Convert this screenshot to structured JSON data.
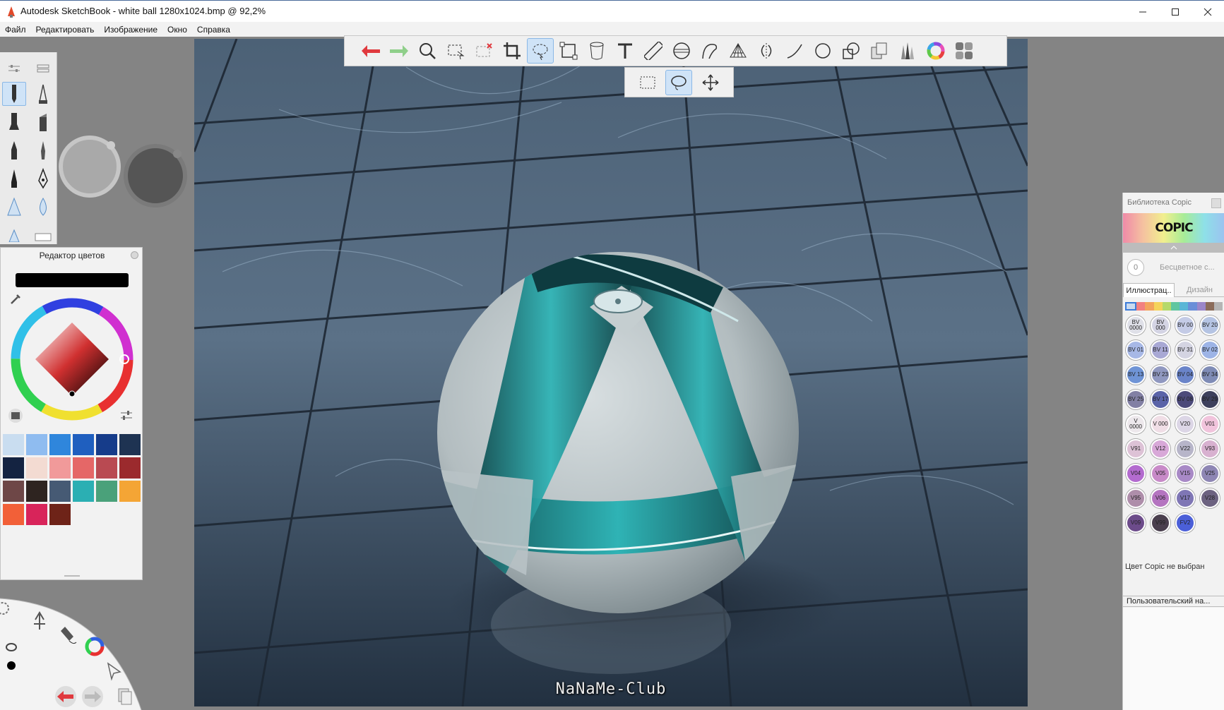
{
  "window": {
    "title": "Autodesk SketchBook - white ball 1280x1024.bmp @ 92,2%"
  },
  "menu": [
    "Файл",
    "Редактировать",
    "Изображение",
    "Окно",
    "Справка"
  ],
  "toolbar": {
    "icons": [
      "undo-icon",
      "redo-icon",
      "zoom-icon",
      "select-icon",
      "deselect-icon",
      "crop-icon",
      "lasso-select-icon",
      "transform-icon",
      "fill-icon",
      "text-icon",
      "ruler-icon",
      "ellipse-guide-icon",
      "french-curve-icon",
      "perspective-icon",
      "symmetry-icon",
      "line-icon",
      "circle-icon",
      "shape-icon",
      "layer-icon",
      "brush-library-icon",
      "color-wheel-icon",
      "copic-library-icon"
    ],
    "active": "lasso-select-icon",
    "colors": {
      "undo": "#e0393e",
      "redo": "#8fcf8a",
      "active_bg": "#cfe3f7"
    }
  },
  "selection_subbar": {
    "icons": [
      "rectangle-select-icon",
      "lasso-select-icon",
      "move-select-icon"
    ],
    "active": "lasso-select-icon"
  },
  "canvas": {
    "watermark": "NaNaMe-Club"
  },
  "color_editor": {
    "title": "Редактор цветов",
    "current_color": "#000000",
    "swatches": [
      "#c9ddf0",
      "#8fbcf0",
      "#2f86dc",
      "#1f5fbf",
      "#163c8a",
      "#1e3352",
      "#142341",
      "#f3dbd2",
      "#f19a9a",
      "#e56767",
      "#b94a52",
      "#9b2a2d",
      "#6e4747",
      "#2e2420",
      "#465a74",
      "#2bafb3",
      "#4aa17a",
      "#f4a535",
      "#f26038",
      "#d8245a",
      "#6e2318"
    ]
  },
  "copic_library": {
    "title": "Библиотека Copic",
    "logo": "COPIC",
    "blender_value": "0",
    "blender_label": "Бесцветное с...",
    "tabs": [
      "Иллюстрац..",
      "Дизайн"
    ],
    "active_tab": "Иллюстрац..",
    "hue_strip": [
      "#f3a6b7",
      "#f28080",
      "#f3a45d",
      "#f5d35a",
      "#b5d96a",
      "#60c6a0",
      "#5ab6d6",
      "#6a8ed8",
      "#9b86c9",
      "#8b6c5a",
      "#b5b5b5"
    ],
    "colors": [
      {
        "code": "BV 0000",
        "color": "#dfe0e8"
      },
      {
        "code": "BV 000",
        "color": "#d4d4e4"
      },
      {
        "code": "BV 00",
        "color": "#c4cbe6"
      },
      {
        "code": "BV 20",
        "color": "#b5c4e3"
      },
      {
        "code": "BV 01",
        "color": "#a7b8e6"
      },
      {
        "code": "BV 11",
        "color": "#a8a8d4"
      },
      {
        "code": "BV 31",
        "color": "#d4d4e2"
      },
      {
        "code": "BV 02",
        "color": "#9db4e6"
      },
      {
        "code": "BV 13",
        "color": "#6f94d6"
      },
      {
        "code": "BV 23",
        "color": "#9098c0"
      },
      {
        "code": "BV 04",
        "color": "#6a84c9"
      },
      {
        "code": "BV 34",
        "color": "#7f8cb6"
      },
      {
        "code": "BV 25",
        "color": "#8280a4"
      },
      {
        "code": "BV 17",
        "color": "#5a63a8"
      },
      {
        "code": "BV 08",
        "color": "#4c4a7a"
      },
      {
        "code": "BV 29",
        "color": "#3d405c"
      },
      {
        "code": "V 0000",
        "color": "#ede8ec"
      },
      {
        "code": "V 000",
        "color": "#f0dee6"
      },
      {
        "code": "V20",
        "color": "#dcd6e6"
      },
      {
        "code": "V01",
        "color": "#f1c4dc"
      },
      {
        "code": "V91",
        "color": "#ddc2d6"
      },
      {
        "code": "V12",
        "color": "#d8a8d8"
      },
      {
        "code": "V22",
        "color": "#b7b5c9"
      },
      {
        "code": "V93",
        "color": "#d8b1d0"
      },
      {
        "code": "V04",
        "color": "#b36bcf"
      },
      {
        "code": "V05",
        "color": "#c88ac8"
      },
      {
        "code": "V15",
        "color": "#a889c6"
      },
      {
        "code": "V25",
        "color": "#8e86b4"
      },
      {
        "code": "V95",
        "color": "#ae8eaa"
      },
      {
        "code": "V06",
        "color": "#b474c0"
      },
      {
        "code": "V17",
        "color": "#7f76b5"
      },
      {
        "code": "V28",
        "color": "#6c6280"
      },
      {
        "code": "V09",
        "color": "#6c4b8a"
      },
      {
        "code": "V99",
        "color": "#4a3f4e"
      },
      {
        "code": "FV2",
        "color": "#4b5fd8"
      }
    ],
    "status": "Цвет Copic не выбран",
    "custom_label": "Пользовательский на..."
  }
}
